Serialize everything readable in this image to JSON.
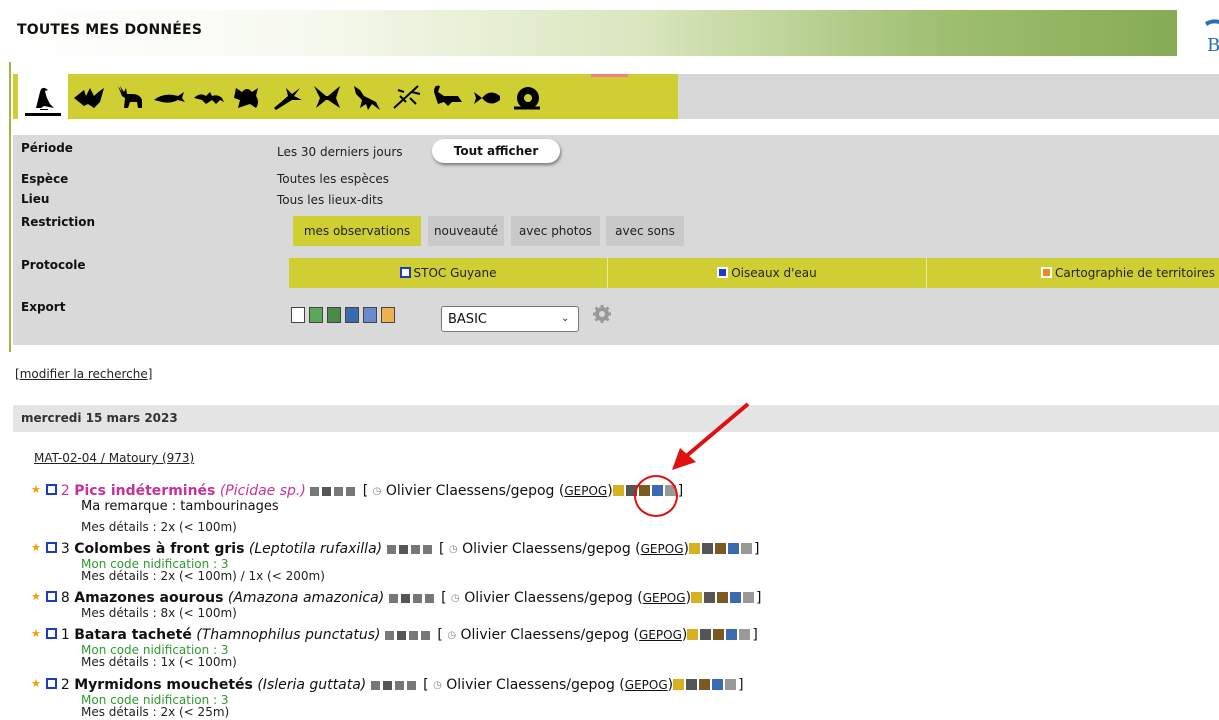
{
  "header": {
    "title": "TOUTES MES DONNÉES",
    "logo_fragment": "B"
  },
  "taxon_tabs": [
    "bird-icon",
    "bat-icon",
    "deer-icon",
    "cetacean-icon",
    "lizard-icon",
    "frog-icon",
    "dragonfly-icon",
    "butterfly-icon",
    "mantis-icon",
    "stick-insect-icon",
    "scorpion-icon",
    "fish-icon",
    "snail-icon"
  ],
  "filters": {
    "periode_label": "Période",
    "periode_value": "Les 30 derniers jours",
    "tout_afficher": "Tout afficher",
    "espece_label": "Espèce",
    "espece_value": "Toutes les espèces",
    "lieu_label": "Lieu",
    "lieu_value": "Tous les lieux-dits",
    "restriction_label": "Restriction",
    "restriction_tabs": [
      "mes observations",
      "nouveauté",
      "avec photos",
      "avec sons"
    ],
    "protocole_label": "Protocole",
    "protocoles": [
      "STOC Guyane",
      "Oiseaux d'eau",
      "Cartographie de territoires"
    ],
    "export_label": "Export",
    "export_format": "BASIC"
  },
  "modify_link": "modifier la recherche",
  "date": "mercredi 15 mars 2023",
  "place": "MAT-02-04 / Matoury (973)",
  "observer": "Olivier Claessens/gepog",
  "org": "GEPOG",
  "observations": [
    {
      "count": "2",
      "name": "Pics indéterminés",
      "latin": "(Picidae sp.)",
      "remark": "Ma remarque : tambourinages",
      "nidif": "",
      "details": "Mes détails : 2x (< 100m)"
    },
    {
      "count": "3",
      "name": "Colombes à front gris",
      "latin": "(Leptotila rufaxilla)",
      "remark": "",
      "nidif": "Mon code nidification : 3",
      "details": "Mes détails : 2x (< 100m) / 1x (< 200m)"
    },
    {
      "count": "8",
      "name": "Amazones aourous",
      "latin": "(Amazona amazonica)",
      "remark": "",
      "nidif": "",
      "details": "Mes détails : 8x (< 100m)"
    },
    {
      "count": "1",
      "name": "Batara tacheté",
      "latin": "(Thamnophilus punctatus)",
      "remark": "",
      "nidif": "Mon code nidification : 3",
      "details": "Mes détails : 1x (< 100m)"
    },
    {
      "count": "2",
      "name": "Myrmidons mouchetés",
      "latin": "(Isleria guttata)",
      "remark": "",
      "nidif": "Mon code nidification : 3",
      "details": "Mes détails : 2x (< 25m)"
    }
  ],
  "colors": {
    "tab_yellow": "#cfcf33",
    "panel_gray": "#d9d9d9",
    "pink_species": "#c8309a",
    "annotation_red": "#e01010"
  }
}
